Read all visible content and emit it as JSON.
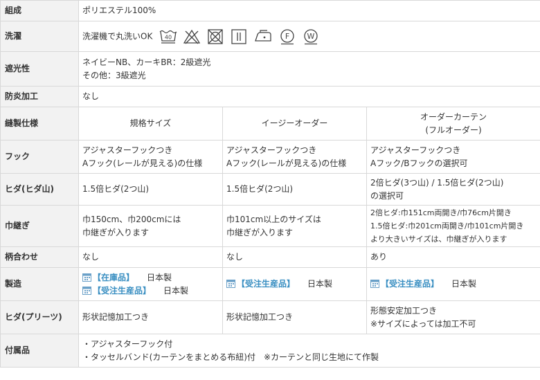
{
  "rows": {
    "composition": {
      "label": "組成",
      "value": "ポリエステル100%"
    },
    "washing": {
      "label": "洗濯",
      "value": "洗濯機で丸洗いOK",
      "icons": [
        "wash-40-icon",
        "no-bleach-icon",
        "no-tumble-dry-icon",
        "line-dry-icon",
        "iron-low-icon",
        "dry-clean-f-icon",
        "wet-clean-w-icon"
      ]
    },
    "shading": {
      "label": "遮光性",
      "line1": "ネイビーNB、カーキBR：2級遮光",
      "line2": "その他：3級遮光"
    },
    "fireproof": {
      "label": "防炎加工",
      "value": "なし"
    },
    "sewing": {
      "label": "縫製仕様",
      "col1": "規格サイズ",
      "col2": "イージーオーダー",
      "col3_line1": "オーダーカーテン",
      "col3_line2": "(フルオーダー)"
    },
    "hook": {
      "label": "フック",
      "col1_line1": "アジャスターフックつき",
      "col1_line2": "Aフック(レールが見える)の仕様",
      "col2_line1": "アジャスターフックつき",
      "col2_line2": "Aフック(レールが見える)の仕様",
      "col3_line1": "アジャスターフックつき",
      "col3_line2": "Aフック/Bフックの選択可"
    },
    "pleat_peaks": {
      "label": "ヒダ(ヒダ山)",
      "col1": "1.5倍ヒダ(2つ山)",
      "col2": "1.5倍ヒダ(2つ山)",
      "col3_line1": "2倍ヒダ(3つ山) / 1.5倍ヒダ(2つ山)",
      "col3_line2": "の選択可"
    },
    "seam": {
      "label": "巾継ぎ",
      "col1_line1": "巾150cm、巾200cmには",
      "col1_line2": "巾継ぎが入ります",
      "col2_line1": "巾101cm以上のサイズは",
      "col2_line2": "巾継ぎが入ります",
      "col3_line1": "2倍ヒダ:巾151cm両開き/巾76cm片開き",
      "col3_line2": "1.5倍ヒダ:巾201cm両開き/巾101cm片開き",
      "col3_line3": "より大きいサイズは、巾継ぎが入ります"
    },
    "pattern": {
      "label": "柄合わせ",
      "col1": "なし",
      "col2": "なし",
      "col3": "あり"
    },
    "manufacture": {
      "label": "製造",
      "stock_tag": "【在庫品】",
      "order_tag": "【受注生産品】",
      "origin": "日本製"
    },
    "pleats": {
      "label": "ヒダ(プリーツ)",
      "col1": "形状記憶加工つき",
      "col2": "形状記憶加工つき",
      "col3_line1": "形態安定加工つき",
      "col3_line2": "※サイズによっては加工不可"
    },
    "accessories": {
      "label": "付属品",
      "line1": "・アジャスターフック付",
      "line2": "・タッセルバンド(カーテンをまとめる布紐)付　※カーテンと同じ生地にて作製"
    }
  },
  "colors": {
    "header_bg": "#f2f2f2",
    "border": "#d8d8d8",
    "tag": "#3a8fc2",
    "text": "#333333"
  }
}
